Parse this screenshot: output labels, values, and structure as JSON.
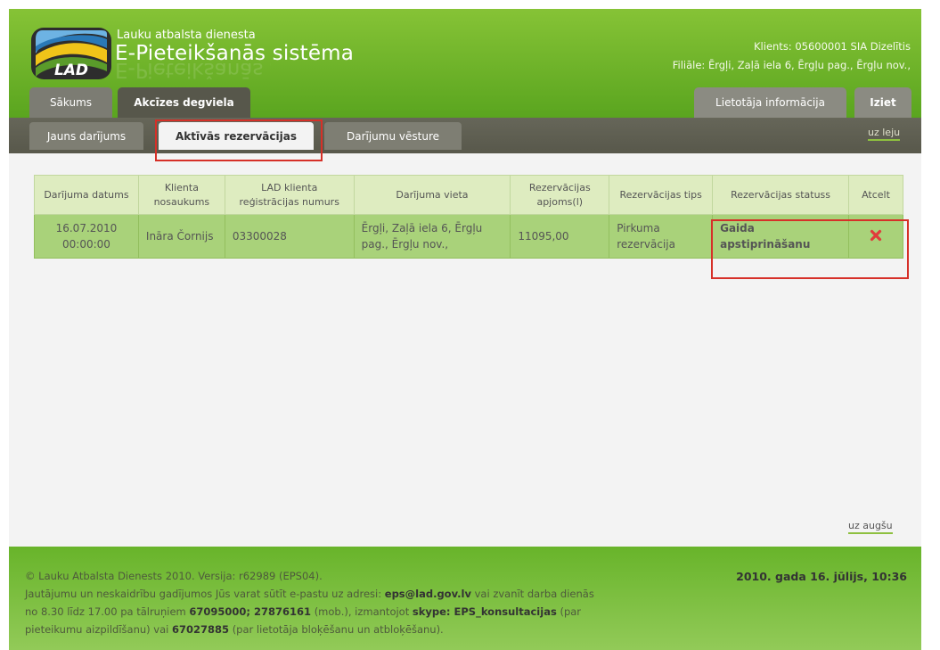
{
  "header": {
    "org_name": "Lauku atbalsta dienesta",
    "system_title": "E-Pieteikšanās sistēma",
    "logo_text": "LAD",
    "client_line": "Klients: 05600001 SIA Dizelītis",
    "branch_line": "Filiāle: Ērgļi, Zaļā iela 6, Ērgļu pag., Ērgļu nov.,"
  },
  "main_tabs": [
    {
      "label": "Sākums"
    },
    {
      "label": "Akcīzes degviela"
    }
  ],
  "right_tabs": [
    {
      "label": "Lietotāja informācija"
    },
    {
      "label": "Iziet"
    }
  ],
  "sub_tabs": [
    {
      "label": "Jauns darījums"
    },
    {
      "label": "Aktīvās rezervācijas"
    },
    {
      "label": "Darījumu vēsture"
    }
  ],
  "links": {
    "down": "uz leju",
    "up": "uz augšu"
  },
  "table": {
    "headers": [
      "Darījuma datums",
      "Klienta nosaukums",
      "LAD klienta reģistrācijas numurs",
      "Darījuma vieta",
      "Rezervācijas apjoms(l)",
      "Rezervācijas tips",
      "Rezervācijas statuss",
      "Atcelt"
    ],
    "rows": [
      {
        "date": "16.07.2010 00:00:00",
        "client": "Ināra Čornijs",
        "reg_no": "03300028",
        "place": "Ērgļi, Zaļā iela 6, Ērgļu pag., Ērgļu nov.,",
        "volume": "11095,00",
        "type": "Pirkuma rezervācija",
        "status": "Gaida apstiprināšanu",
        "cancel_icon": "delete-x-icon"
      }
    ]
  },
  "footer": {
    "copyright": "© Lauku Atbalsta Dienests 2010. Versija: r62989 (EPS04).",
    "contact_1": "Jautājumu un neskaidrību gadījumos Jūs varat sūtīt e-pastu uz adresi:",
    "email": "eps@lad.gov.lv",
    "contact_2": "vai zvanīt darba dienās",
    "contact_3": "no 8.30 līdz 17.00 pa tālruņiem",
    "phones": "67095000; 27876161",
    "contact_4": "(mob.), izmantojot",
    "skype": "skype: EPS_konsultacijas",
    "contact_5": "(par",
    "contact_6": "pieteikumu aizpildīšanu) vai",
    "phone_block": "67027885",
    "contact_7": "(par lietotāja bloķēšanu un atbloķēšanu).",
    "date": "2010. gada 16. jūlijs, 10:36"
  },
  "colors": {
    "header_green": "#5aa51f",
    "nav_dark": "#58584b",
    "table_row": "#a9d27a",
    "table_header": "#deecc0",
    "highlight_red": "#d63028",
    "delete_red": "#e03c3c"
  }
}
